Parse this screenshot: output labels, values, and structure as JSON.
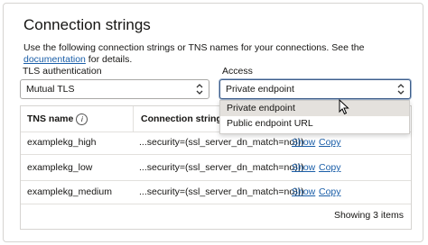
{
  "title": "Connection strings",
  "description": {
    "text_before": "Use the following connection strings or TNS names for your connections. See the ",
    "link": "documentation",
    "text_after": " for details."
  },
  "tls": {
    "label": "TLS authentication",
    "value": "Mutual TLS"
  },
  "access": {
    "label": "Access",
    "value": "Private endpoint",
    "options": [
      "Private endpoint",
      "Public endpoint URL"
    ]
  },
  "table": {
    "columns": [
      "TNS name",
      "Connection string"
    ],
    "rows": [
      {
        "tns": "examplekg_high",
        "conn": "...security=(ssl_server_dn_match=no)))",
        "show": "Show",
        "copy": "Copy"
      },
      {
        "tns": "examplekg_low",
        "conn": "...security=(ssl_server_dn_match=no)))",
        "show": "Show",
        "copy": "Copy"
      },
      {
        "tns": "examplekg_medium",
        "conn": "...security=(ssl_server_dn_match=no)))",
        "show": "Show",
        "copy": "Copy"
      }
    ],
    "footer": "Showing 3 items"
  },
  "icons": {
    "info": "info-icon",
    "chevron": "chevron-updown-icon",
    "cursor": "mouse-pointer-icon"
  },
  "colors": {
    "link": "#1a5ea8",
    "focus_border": "#3d5d8a",
    "highlight": "#e4e1dd"
  }
}
